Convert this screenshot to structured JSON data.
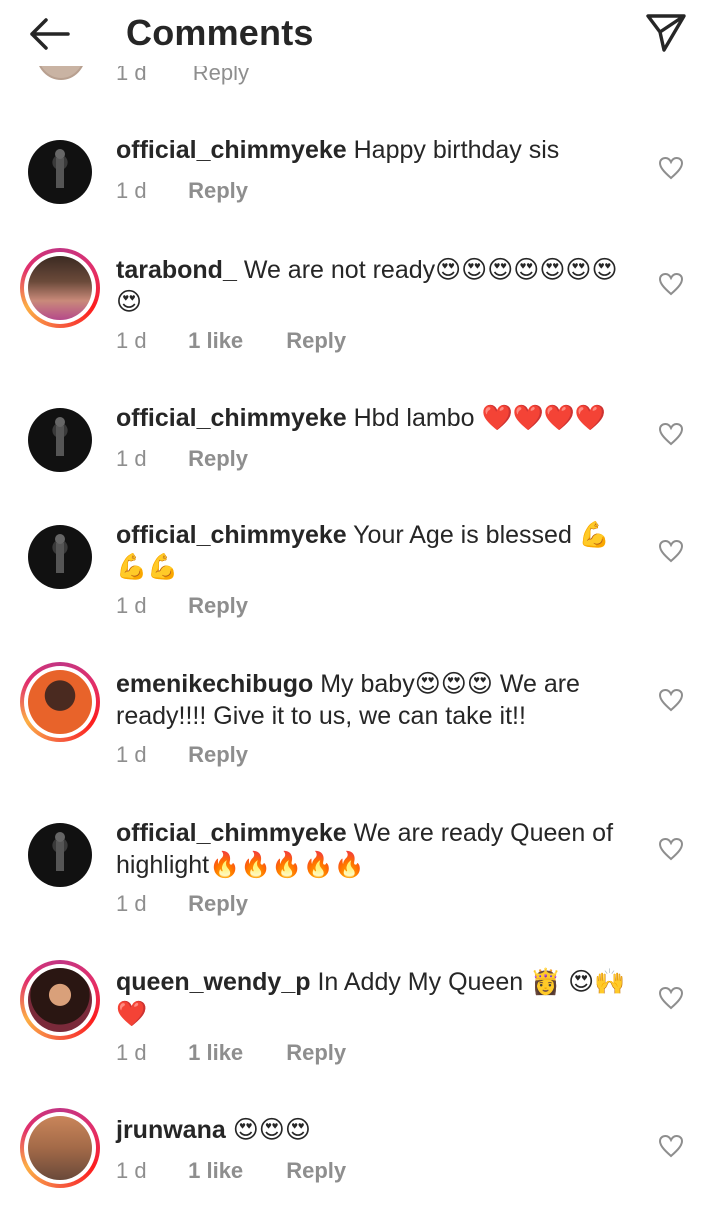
{
  "header": {
    "title": "Comments"
  },
  "partial": {
    "time": "1 d",
    "reply": "Reply"
  },
  "comments": [
    {
      "user": "official_chimmyeke",
      "text": "Happy birthday sis",
      "time": "1 d",
      "likes": "",
      "reply": "Reply"
    },
    {
      "user": "tarabond_",
      "text": "We are not ready😍😍😍😍😍😍😍😍",
      "time": "1 d",
      "likes": "1 like",
      "reply": "Reply"
    },
    {
      "user": "official_chimmyeke",
      "text": "Hbd lambo ❤️❤️❤️❤️",
      "time": "1 d",
      "likes": "",
      "reply": "Reply"
    },
    {
      "user": "official_chimmyeke",
      "text": "Your Age is blessed 💪💪💪",
      "time": "1 d",
      "likes": "",
      "reply": "Reply"
    },
    {
      "user": "emenikechibugo",
      "text": "My baby😍😍😍 We are ready!!!! Give it to us, we can take it!!",
      "time": "1 d",
      "likes": "",
      "reply": "Reply"
    },
    {
      "user": "official_chimmyeke",
      "text": "We are ready Queen of highlight🔥🔥🔥🔥🔥",
      "time": "1 d",
      "likes": "",
      "reply": "Reply"
    },
    {
      "user": "queen_wendy_p",
      "text": "In Addy My Queen 👸 😍🙌❤️",
      "time": "1 d",
      "likes": "1 like",
      "reply": "Reply"
    },
    {
      "user": "jrunwana",
      "text": "😍😍😍",
      "time": "1 d",
      "likes": "1 like",
      "reply": "Reply"
    }
  ]
}
